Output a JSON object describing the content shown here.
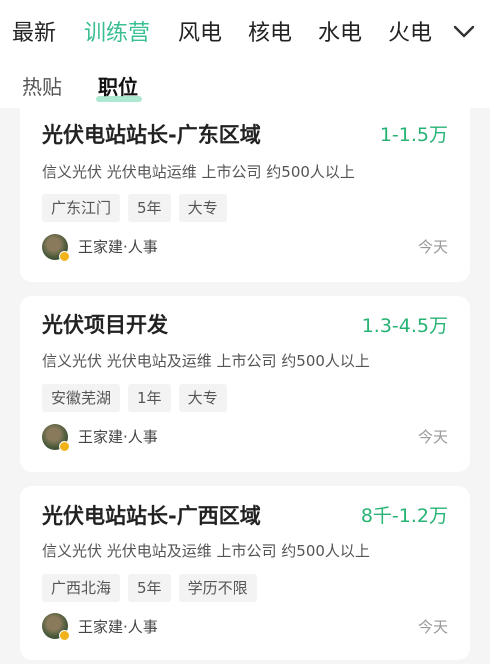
{
  "nav": {
    "tabs": [
      {
        "label": "最新"
      },
      {
        "label": "训练营"
      },
      {
        "label": "风电"
      },
      {
        "label": "核电"
      },
      {
        "label": "水电"
      },
      {
        "label": "火电"
      }
    ],
    "active_tab": "训练营",
    "more_icon": "chevron-down-icon"
  },
  "subtabs": {
    "items": [
      {
        "label": "热贴"
      },
      {
        "label": "职位"
      }
    ],
    "active": "职位"
  },
  "jobs": [
    {
      "title": "光伏电站站长-广东区域",
      "salary": "1-1.5万",
      "company": "信义光伏 光伏电站运维 上市公司 约500人以上",
      "tags": [
        "广东江门",
        "5年",
        "大专"
      ],
      "recruiter": "王家建·人事",
      "time": "今天"
    },
    {
      "title": "光伏项目开发",
      "salary": "1.3-4.5万",
      "company": "信义光伏 光伏电站及运维 上市公司 约500人以上",
      "tags": [
        "安徽芜湖",
        "1年",
        "大专"
      ],
      "recruiter": "王家建·人事",
      "time": "今天"
    },
    {
      "title": "光伏电站站长-广西区域",
      "salary": "8千-1.2万",
      "company": "信义光伏 光伏电站及运维 上市公司 约500人以上",
      "tags": [
        "广西北海",
        "5年",
        "学历不限"
      ],
      "recruiter": "王家建·人事",
      "time": "今天"
    }
  ],
  "colors": {
    "accent": "#3bbf92",
    "salary": "#27b374",
    "background": "#f5f5f5"
  }
}
